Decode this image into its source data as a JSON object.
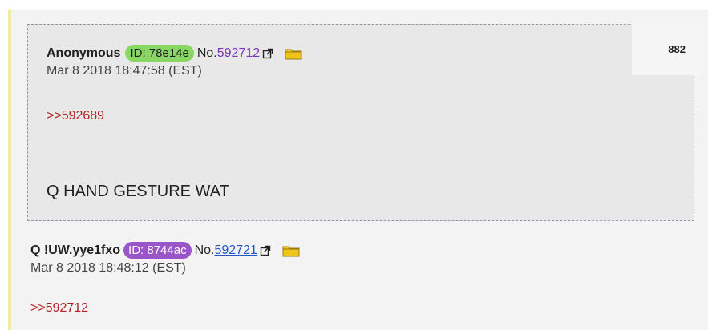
{
  "reply_count": "882",
  "posts": [
    {
      "author": "Anonymous",
      "id_label": "ID: 78e14e",
      "no_label": "No.",
      "post_no": "592712",
      "date": "Mar 8 2018 18:47:58 (EST)",
      "quote": ">>592689",
      "body": "Q HAND GESTURE WAT",
      "id_color": "#88d765"
    },
    {
      "author": "Q !UW.yye1fxo",
      "id_label": "ID: 8744ac",
      "no_label": "No.",
      "post_no": "592721",
      "date": "Mar 8 2018 18:48:12 (EST)",
      "quote": ">>592712",
      "id_color": "#9a55c9"
    }
  ],
  "colors": {
    "thread_border": "#f2eaa2",
    "quote": "#b02323",
    "folder": "#f0c419"
  },
  "icons": [
    "external-link-icon",
    "folder-icon"
  ]
}
